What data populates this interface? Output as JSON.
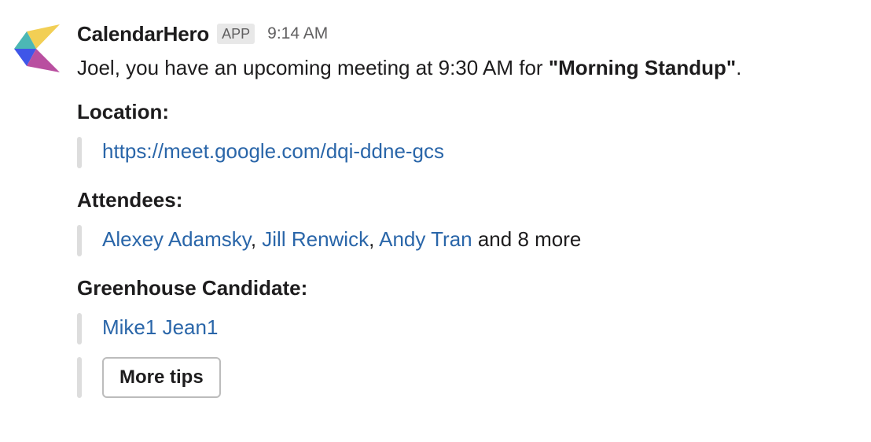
{
  "sender": {
    "name": "CalendarHero",
    "badge": "APP",
    "time": "9:14 AM"
  },
  "message": {
    "prefix": "Joel, you have an upcoming meeting at 9:30 AM for ",
    "meeting_title": "\"Morning Standup\"",
    "suffix": "."
  },
  "location": {
    "label": "Location:",
    "link": "https://meet.google.com/dqi-ddne-gcs"
  },
  "attendees": {
    "label": "Attendees:",
    "names": [
      "Alexey Adamsky",
      "Jill Renwick",
      "Andy Tran"
    ],
    "separator": ", ",
    "more": " and 8 more"
  },
  "candidate": {
    "label": "Greenhouse Candidate:",
    "name": "Mike1 Jean1"
  },
  "actions": {
    "more_tips_label": "More tips"
  },
  "colors": {
    "link": "#2a66a9",
    "text": "#1d1c1d",
    "muted": "#616061",
    "quote_bar": "#dddddd",
    "logo_yellow": "#f2cf55",
    "logo_teal": "#4cb7b5",
    "logo_blue": "#3f56e8",
    "logo_purple": "#b94fa0"
  }
}
